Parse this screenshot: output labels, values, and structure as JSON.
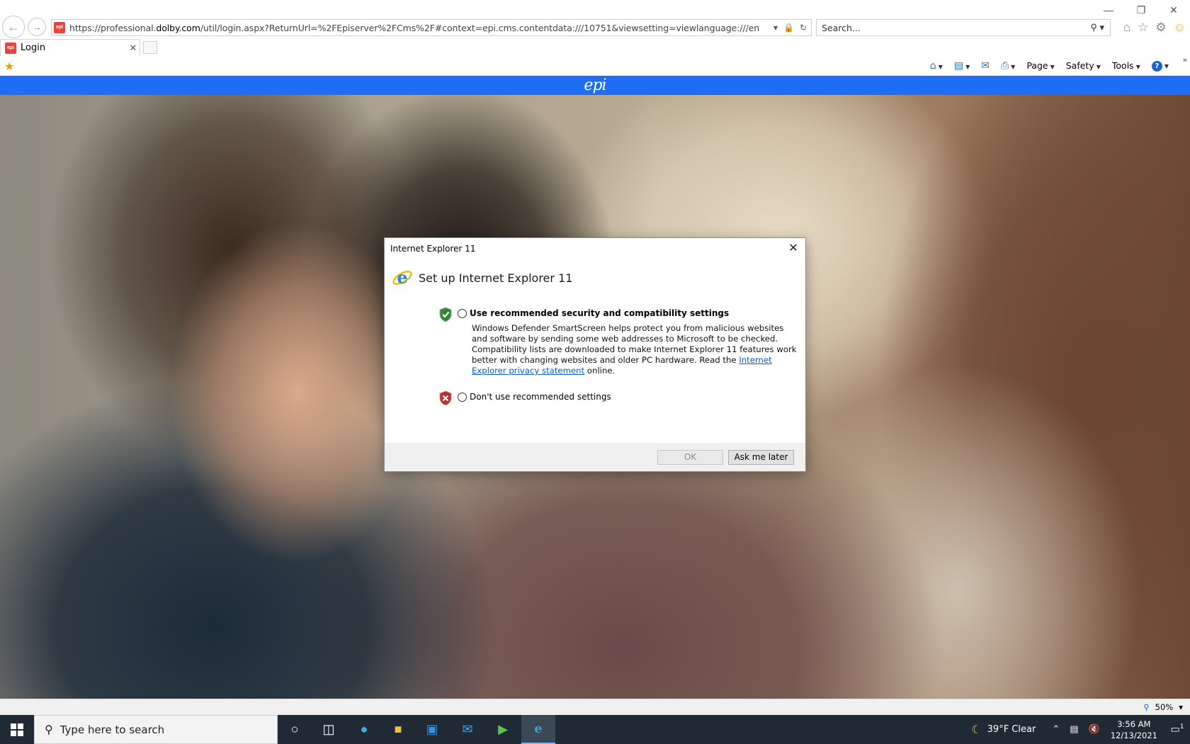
{
  "browser": {
    "url_prefix": "https://professional.",
    "url_domain": "dolby.com",
    "url_rest": "/util/login.aspx?ReturnUrl=%2FEpiserver%2FCms%2F#context=epi.cms.contentdata:///10751&viewsetting=viewlanguage:///en",
    "search_placeholder": "Search...",
    "tab_title": "Login",
    "favicon_text": "epi",
    "menu": {
      "page": "Page",
      "safety": "Safety",
      "tools": "Tools"
    },
    "zoom": "50%"
  },
  "page": {
    "logo": "epi",
    "brand_color": "#1e6ef5"
  },
  "dialog": {
    "title": "Internet Explorer 11",
    "heading": "Set up Internet Explorer 11",
    "option1_label": "Use recommended security and compatibility settings",
    "option1_desc_before": "Windows Defender SmartScreen helps protect you from malicious websites and software by sending some web addresses to Microsoft to be checked. Compatibility lists are downloaded to make Internet Explorer 11 features work better with changing websites and older PC hardware. Read the ",
    "option1_link": "Internet Explorer privacy statement",
    "option1_desc_after": " online.",
    "option2_label": "Don't use recommended settings",
    "ok_button": "OK",
    "later_button": "Ask me later"
  },
  "taskbar": {
    "search_placeholder": "Type here to search",
    "weather": "39°F  Clear",
    "time": "3:56 AM",
    "date": "12/13/2021",
    "notification_count": "1"
  }
}
